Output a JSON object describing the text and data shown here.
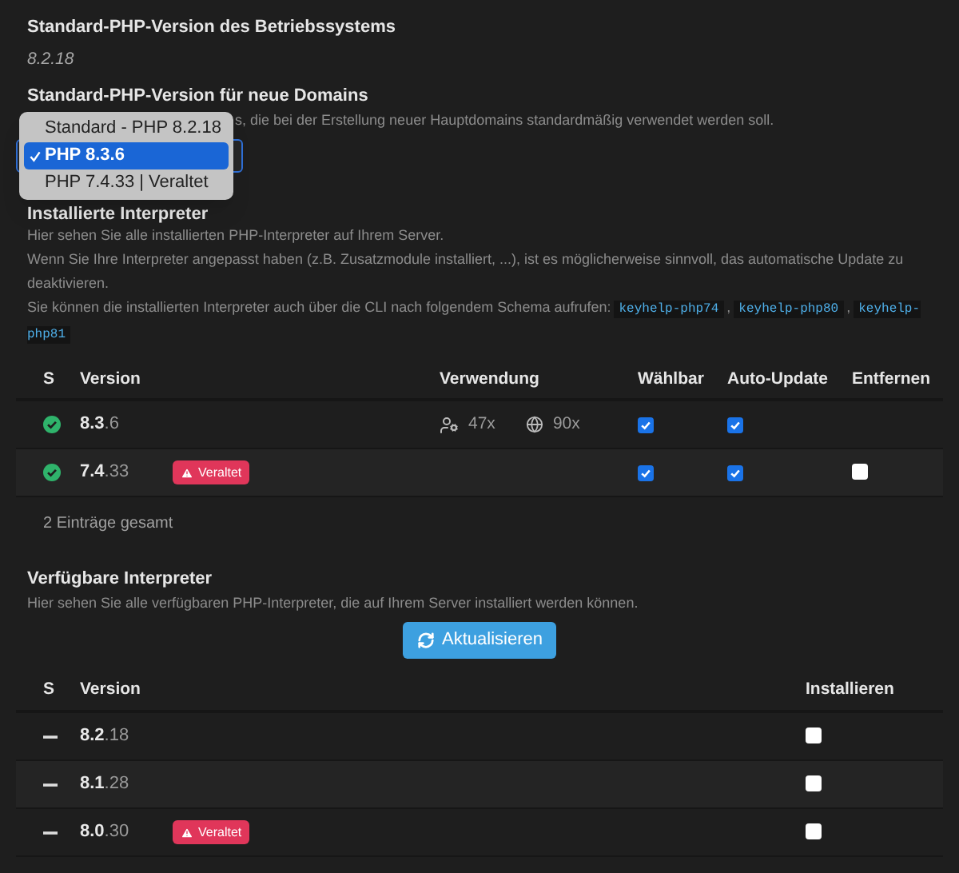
{
  "os_default": {
    "title": "Standard-PHP-Version des Betriebssystems",
    "value": "8.2.18"
  },
  "new_domains": {
    "title": "Standard-PHP-Version für neue Domains",
    "description": "s, die bei der Erstellung neuer Hauptdomains standardmäßig verwendet werden soll.",
    "options": [
      {
        "label": "Standard - PHP 8.2.18",
        "selected": false
      },
      {
        "label": "PHP 8.3.6",
        "selected": true
      },
      {
        "label": "PHP 7.4.33 | Veraltet",
        "selected": false
      }
    ]
  },
  "installed": {
    "title": "Installierte Interpreter",
    "lines": [
      "Hier sehen Sie alle installierten PHP-Interpreter auf Ihrem Server.",
      "Wenn Sie Ihre Interpreter angepasst haben (z.B. Zusatzmodule installiert, ...), ist es möglicherweise sinnvoll, das automatische Update zu deaktivieren."
    ],
    "cli": [
      {
        "kind": "text",
        "text": "Sie können die installierten Interpreter auch über die CLI nach folgendem Schema aufrufen:"
      },
      {
        "kind": "code",
        "text": "keyhelp-php74"
      },
      {
        "kind": "text",
        "text": ","
      },
      {
        "kind": "code",
        "text": "keyhelp-php80"
      },
      {
        "kind": "text",
        "text": ","
      },
      {
        "kind": "code",
        "text": "keyhelp-php81"
      }
    ],
    "columns": [
      "S",
      "Version",
      "Verwendung",
      "Wählbar",
      "Auto-Update",
      "Entfernen"
    ],
    "rows": [
      {
        "installed": true,
        "version": "**8.3**.6",
        "usage": [
          {
            "kind": "users",
            "count": "47x"
          },
          {
            "kind": "domains",
            "count": "90x"
          }
        ],
        "selectable": true,
        "auto_update": true
      },
      {
        "installed": true,
        "version": "**7.4**.33",
        "badge": "Veraltet",
        "selectable": true,
        "auto_update": true,
        "remove": false
      }
    ],
    "footer": "2 Einträge gesamt"
  },
  "available": {
    "title": "Verfügbare Interpreter",
    "description": "Hier sehen Sie alle verfügbaren PHP-Interpreter, die auf Ihrem Server installiert werden können.",
    "button": "Aktualisieren",
    "columns": [
      "S",
      "Version",
      "Installieren"
    ],
    "rows": [
      {
        "installed": false,
        "version": "**8.2**.18",
        "install": false
      },
      {
        "installed": false,
        "version": "**8.1**.28",
        "install": false
      },
      {
        "installed": false,
        "version": "**8.0**.30",
        "badge": "Veraltet",
        "install": false
      }
    ]
  }
}
